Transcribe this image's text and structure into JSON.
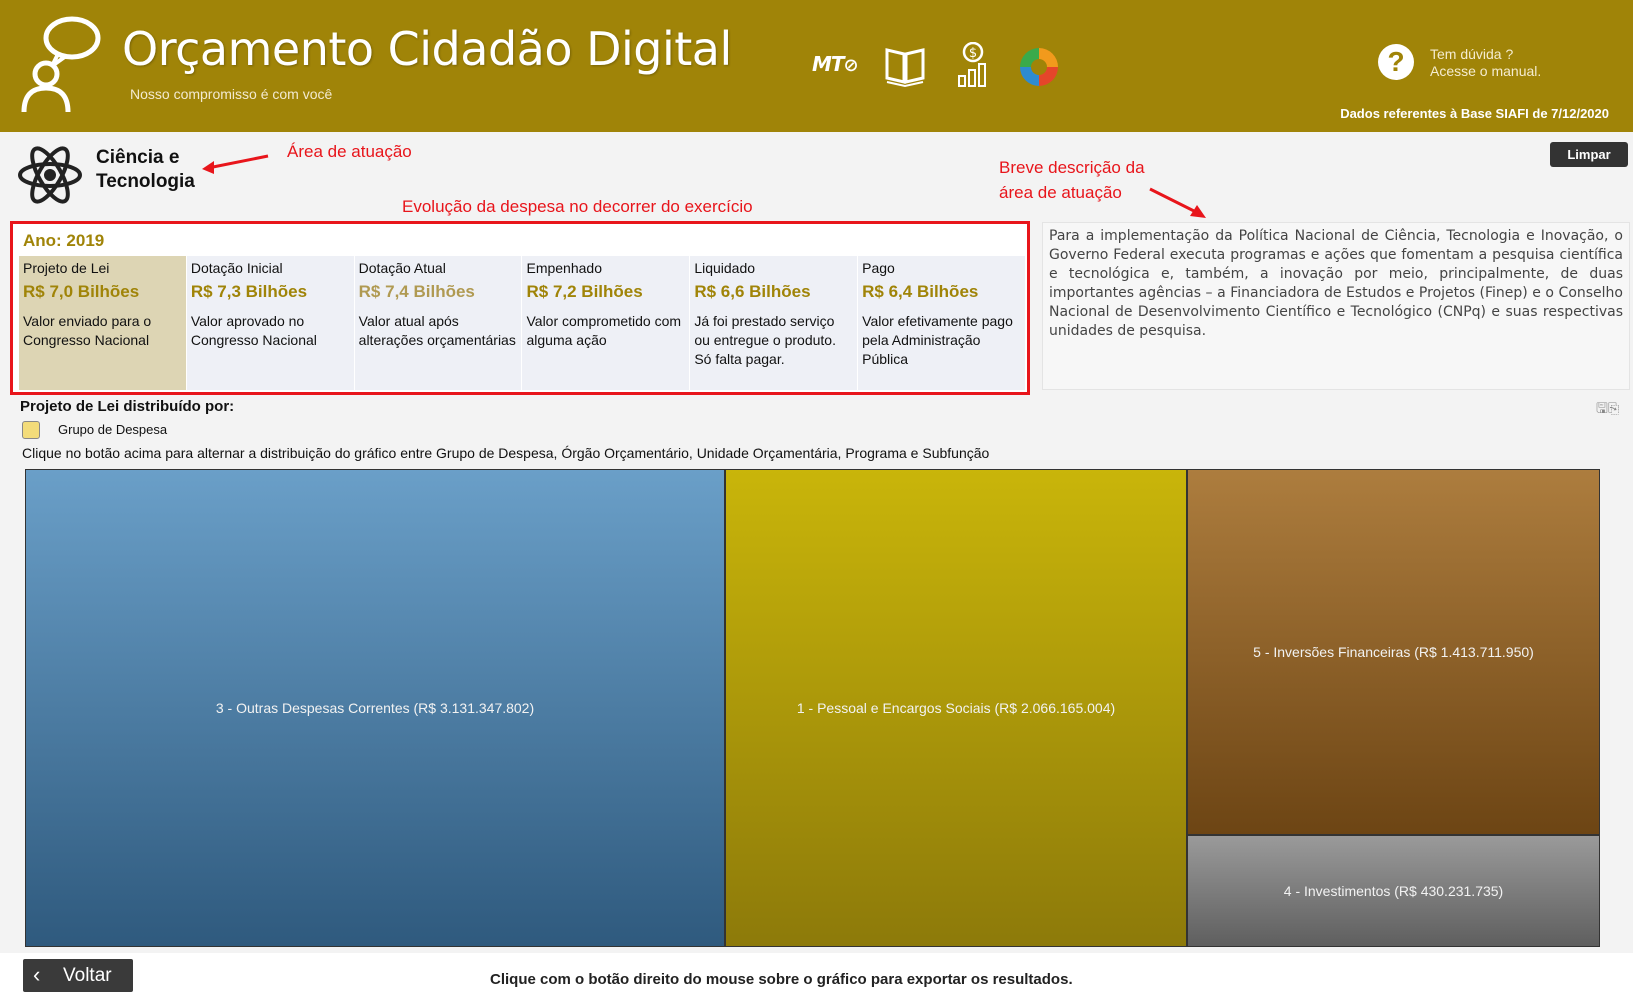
{
  "header": {
    "title": "Orçamento Cidadão Digital",
    "subtitle": "Nosso compromisso é com você",
    "mt_logo": "MT",
    "help_line1": "Tem dúvida ?",
    "help_line2": "Acesse o manual.",
    "siafi_date": "Dados referentes à Base SIAFI de 7/12/2020"
  },
  "area": {
    "title": "Ciência e Tecnologia",
    "icon": "atom-icon",
    "clear_label": "Limpar"
  },
  "annotations": {
    "area": "Área de atuação",
    "evolution": "Evolução da despesa no decorrer do exercício",
    "description_line1": "Breve descrição da",
    "description_line2": "área de atuação"
  },
  "year": {
    "label": "Ano: 2019",
    "stages": [
      {
        "name": "Projeto de Lei",
        "value": "R$ 7,0 Bilhões",
        "desc": "Valor enviado para o Congresso Nacional"
      },
      {
        "name": "Dotação Inicial",
        "value": "R$ 7,3 Bilhões",
        "desc": "Valor aprovado no Congresso Nacional"
      },
      {
        "name": "Dotação Atual",
        "value": "R$ 7,4 Bilhões",
        "desc": "Valor atual após alterações orçamentárias"
      },
      {
        "name": "Empenhado",
        "value": "R$ 7,2 Bilhões",
        "desc": "Valor comprometido com alguma ação"
      },
      {
        "name": "Liquidado",
        "value": "R$ 6,6 Bilhões",
        "desc": "Já foi prestado serviço ou entregue o produto. Só falta pagar."
      },
      {
        "name": "Pago",
        "value": "R$ 6,4 Bilhões",
        "desc": "Valor efetivamente pago pela Administração Pública"
      }
    ]
  },
  "description": "Para a implementação da Política Nacional de Ciência, Tecnologia e Inovação, o Governo Federal executa programas e ações que fomentam a pesquisa científica e tecnológica e, também, a inovação por meio, principalmente, de duas importantes agências – a Financiadora de Estudos e Projetos (Finep) e o Conselho Nacional de Desenvolvimento Científico e Tecnológico (CNPq) e suas respectivas unidades de pesquisa.",
  "distribution": {
    "title": "Projeto de Lei distribuído por:",
    "toggle_label": "Grupo de Despesa",
    "hint": "Clique no botão acima para alternar a distribuição do gráfico entre Grupo de Despesa, Órgão Orçamentário, Unidade Orçamentária, Programa e Subfunção"
  },
  "treemap": {
    "tiles": [
      {
        "label": "3 - Outras Despesas Correntes (R$ 3.131.347.802)",
        "value": 3131347802,
        "color_top": "#6a9fc8",
        "color_bottom": "#2f5a7e"
      },
      {
        "label": "1 - Pessoal e Encargos Sociais (R$ 2.066.165.004)",
        "value": 2066165004,
        "color_top": "#c9b50a",
        "color_bottom": "#8d7a0a"
      },
      {
        "label": "5 - Inversões Financeiras (R$ 1.413.711.950)",
        "value": 1413711950,
        "color_top": "#ad7d3e",
        "color_bottom": "#6d4514"
      },
      {
        "label": "4 - Investimentos (R$ 430.231.735)",
        "value": 430231735,
        "color_top": "#9a9a9a",
        "color_bottom": "#5f5f5f"
      }
    ]
  },
  "footer": {
    "back_label": "Voltar",
    "note": "Clique com o botão direito do mouse sobre o gráfico para exportar os resultados."
  }
}
